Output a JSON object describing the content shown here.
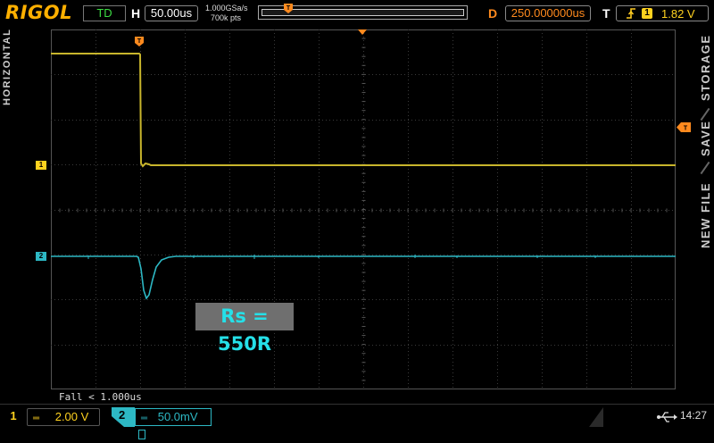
{
  "header": {
    "logo": "RIGOL",
    "trigger_status": "TD",
    "h_label": "H",
    "timebase": "50.00us",
    "sample_rate": "1.000GSa/s",
    "memory_depth": "700k pts",
    "d_label": "D",
    "delay": "250.000000us",
    "t_label": "T",
    "trigger_source": "1",
    "trigger_level": "1.82 V"
  },
  "side_left": {
    "label": "HORIZONTAL"
  },
  "side_right": {
    "items": [
      "STORAGE",
      "SAVE",
      "NEW FILE"
    ]
  },
  "markers": {
    "trigger_pos": "T",
    "ch1_marker": "1",
    "ch2_marker": "2",
    "trigger_level_marker": "T"
  },
  "measurement": {
    "text": "Fall < 1.000us"
  },
  "annotation": {
    "text": "Rs = 550R"
  },
  "footer": {
    "ch1_num": "1",
    "ch1_coupling": "═",
    "ch1_scale": "2.00 V",
    "ch2_num": "2",
    "ch2_coupling": "═",
    "ch2_scale": "50.0mV",
    "usb_icon": "usb-icon",
    "time": "14:27"
  },
  "colors": {
    "ch1": "#c8b52c",
    "ch2": "#2db8c4",
    "accent": "#ff8a1e",
    "logo": "#ffb000"
  }
}
